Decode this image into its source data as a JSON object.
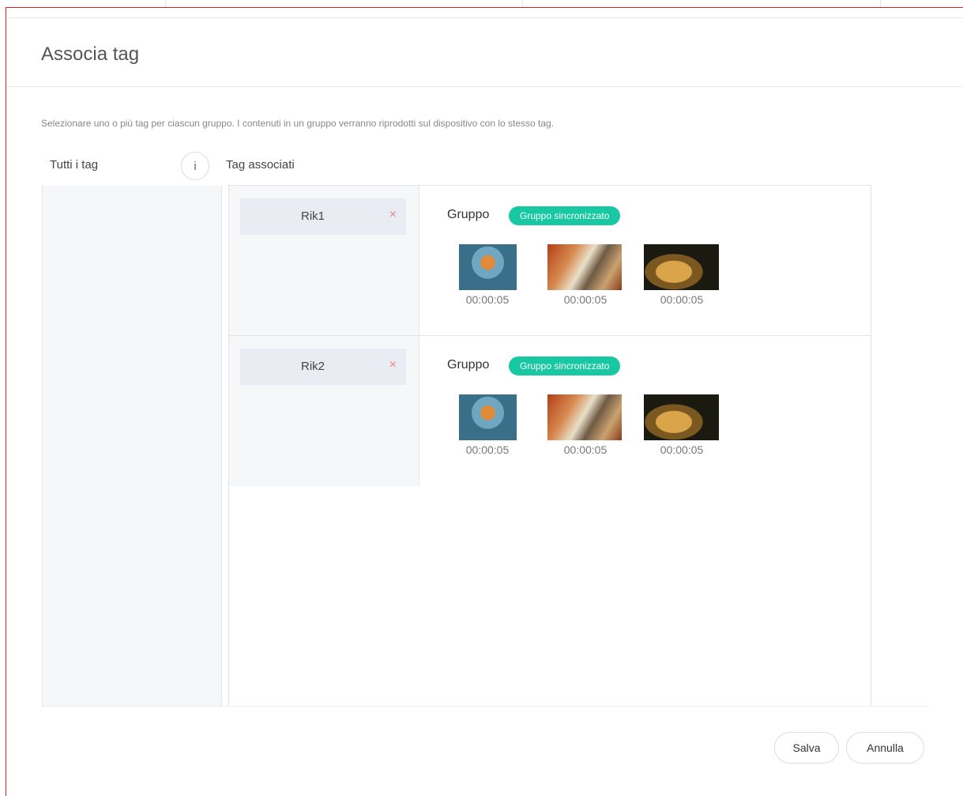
{
  "modal": {
    "title": "Associa tag",
    "description": "Selezionare uno o più tag per ciascun gruppo. I contenuti in un gruppo verranno riprodotti sul dispositivo con lo stesso tag."
  },
  "columns": {
    "all_tags_label": "Tutti i tag",
    "info_icon": "i",
    "associated_label": "Tag associati"
  },
  "groups": [
    {
      "tag": "Rik1",
      "remove_icon": "×",
      "group_label": "Gruppo",
      "badge": "Gruppo sincronizzato",
      "items": [
        {
          "thumb": "tiger",
          "duration": "00:00:05"
        },
        {
          "thumb": "wolf",
          "duration": "00:00:05"
        },
        {
          "thumb": "leopard",
          "duration": "00:00:05"
        }
      ]
    },
    {
      "tag": "Rik2",
      "remove_icon": "×",
      "group_label": "Gruppo",
      "badge": "Gruppo sincronizzato",
      "items": [
        {
          "thumb": "tiger",
          "duration": "00:00:05"
        },
        {
          "thumb": "wolf",
          "duration": "00:00:05"
        },
        {
          "thumb": "leopard",
          "duration": "00:00:05"
        }
      ]
    }
  ],
  "footer": {
    "save_label": "Salva",
    "cancel_label": "Annulla"
  },
  "colors": {
    "badge": "#18c8a3",
    "remove": "#f08080",
    "modal_border": "#e02020"
  }
}
